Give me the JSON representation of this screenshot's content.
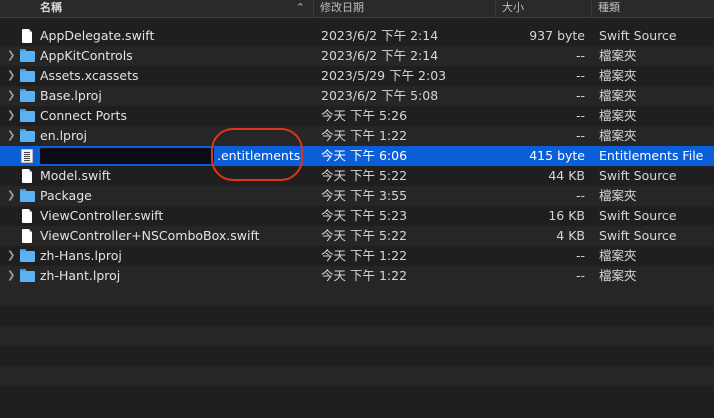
{
  "header": {
    "name": "名稱",
    "date": "修改日期",
    "size": "大小",
    "kind": "種類"
  },
  "files": [
    {
      "name": "AppDelegate.swift",
      "date": "2023/6/2 下午 2:14",
      "size": "937 byte",
      "kind": "Swift Source",
      "icon": "swift-file-icon"
    },
    {
      "name": "AppKitControls",
      "date": "2023/6/2 下午 2:14",
      "size": "--",
      "kind": "檔案夾",
      "icon": "folder-icon"
    },
    {
      "name": "Assets.xcassets",
      "date": "2023/5/29 下午 2:03",
      "size": "--",
      "kind": "檔案夾",
      "icon": "folder-icon"
    },
    {
      "name": "Base.lproj",
      "date": "2023/6/2 下午 5:08",
      "size": "--",
      "kind": "檔案夾",
      "icon": "folder-icon"
    },
    {
      "name": "Connect Ports",
      "date": "今天 下午 5:26",
      "size": "--",
      "kind": "檔案夾",
      "icon": "folder-icon"
    },
    {
      "name": "en.lproj",
      "date": "今天 下午 1:22",
      "size": "--",
      "kind": "檔案夾",
      "icon": "folder-icon"
    },
    {
      "name": ".entitlements",
      "date": "今天 下午 6:06",
      "size": "415 byte",
      "kind": "Entitlements File",
      "icon": "entitlements-file-icon"
    },
    {
      "name": "Model.swift",
      "date": "今天 下午 5:22",
      "size": "44 KB",
      "kind": "Swift Source",
      "icon": "swift-file-icon"
    },
    {
      "name": "Package",
      "date": "今天 下午 3:55",
      "size": "--",
      "kind": "檔案夾",
      "icon": "folder-icon"
    },
    {
      "name": "ViewController.swift",
      "date": "今天 下午 5:23",
      "size": "16 KB",
      "kind": "Swift Source",
      "icon": "swift-file-icon"
    },
    {
      "name": "ViewController+NSComboBox.swift",
      "date": "今天 下午 5:22",
      "size": "4 KB",
      "kind": "Swift Source",
      "icon": "swift-file-icon"
    },
    {
      "name": "zh-Hans.lproj",
      "date": "今天 下午 1:22",
      "size": "--",
      "kind": "檔案夾",
      "icon": "folder-icon"
    },
    {
      "name": "zh-Hant.lproj",
      "date": "今天 下午 1:22",
      "size": "--",
      "kind": "檔案夾",
      "icon": "folder-icon"
    }
  ],
  "selected_row": 6,
  "colors": {
    "background": "#1f1f1f",
    "stripe": "#262626",
    "selection": "#0a5fd8",
    "folder": "#59b2f5",
    "annotation": "#e0341c"
  }
}
